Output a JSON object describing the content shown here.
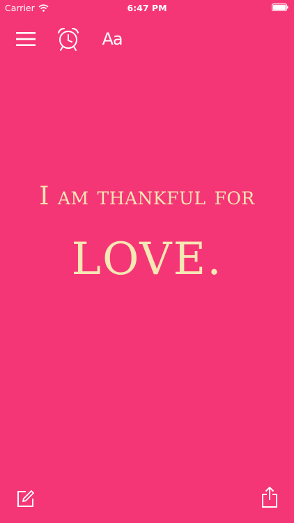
{
  "status_bar": {
    "carrier": "Carrier",
    "time": "6:47 PM",
    "icons": [
      "wifi-icon",
      "battery-icon"
    ]
  },
  "toolbar": {
    "menu_icon": "hamburger-menu-icon",
    "alarm_icon": "alarm-clock-icon",
    "font_label": "Aa"
  },
  "quote": {
    "line": "I am thankful for",
    "word": "LOVE."
  },
  "bottom_toolbar": {
    "compose_icon": "compose-icon",
    "share_icon": "share-icon"
  },
  "colors": {
    "background": "#f53676",
    "text": "#f6e7b4",
    "icons": "#ffffff"
  }
}
